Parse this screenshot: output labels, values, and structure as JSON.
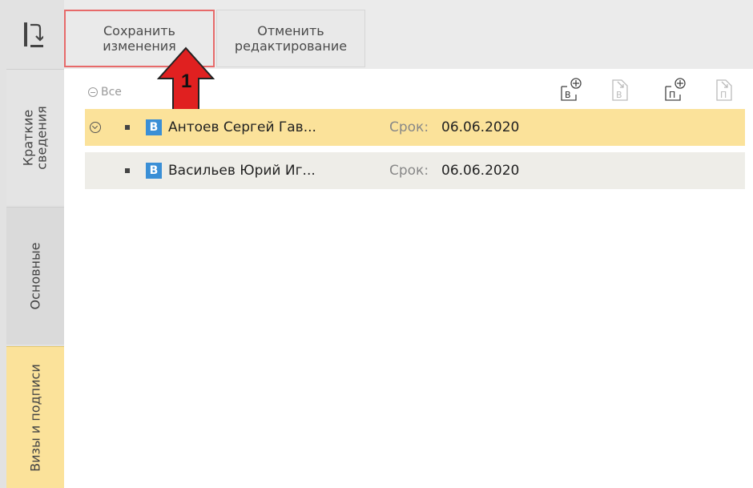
{
  "toolbar": {
    "save_label": "Сохранить\nизменения",
    "cancel_label": "Отменить\nредактирование"
  },
  "annotation": {
    "number": "1",
    "arrow_color": "#e02020"
  },
  "sidebar": {
    "tabs": [
      {
        "label": "Краткие\nсведения",
        "active": false
      },
      {
        "label": "Основные",
        "active": false
      },
      {
        "label": "Визы и подписи",
        "active": true
      }
    ]
  },
  "list": {
    "all_toggle_label": "Все",
    "header_icons": [
      {
        "icon": "add-visa-icon",
        "letter": "В",
        "enabled": true
      },
      {
        "icon": "remove-visa-icon",
        "letter": "В",
        "enabled": false
      },
      {
        "icon": "add-signature-icon",
        "letter": "П",
        "enabled": true
      },
      {
        "icon": "remove-signature-icon",
        "letter": "П",
        "enabled": false
      }
    ],
    "rows": [
      {
        "badge": "В",
        "name": "Антоев Сергей Гав...",
        "deadline_label": "Срок:",
        "deadline": "06.06.2020",
        "selected": true,
        "expandable": true
      },
      {
        "badge": "В",
        "name": "Васильев Юрий Иг...",
        "deadline_label": "Срок:",
        "deadline": "06.06.2020",
        "selected": false,
        "expandable": false
      }
    ]
  },
  "colors": {
    "highlight": "#fbe29a",
    "badge": "#3a8fd6",
    "save_border": "#e76a6a"
  }
}
